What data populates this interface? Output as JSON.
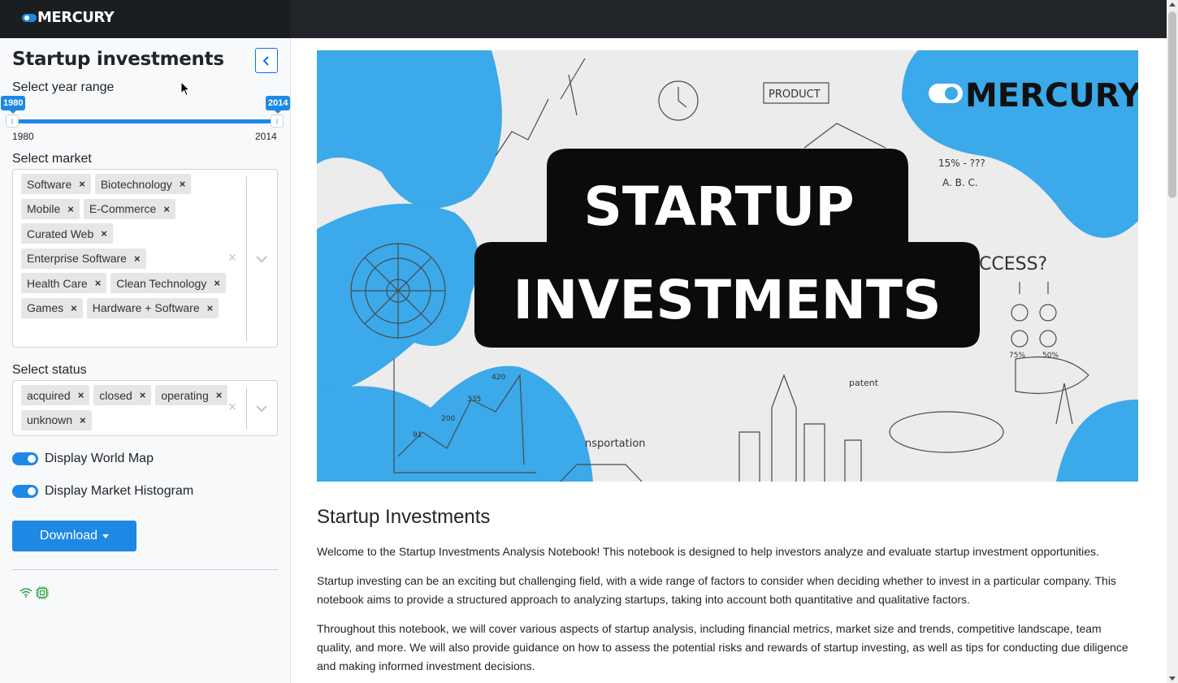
{
  "app": {
    "brand": "MERCURY"
  },
  "sidebar": {
    "title": "Startup investments",
    "year_range": {
      "label": "Select year range",
      "min": 1980,
      "max": 2014,
      "from": 1980,
      "to": 2014,
      "from_label": "1980",
      "to_label": "2014",
      "scale_min_label": "1980",
      "scale_max_label": "2014"
    },
    "market": {
      "label": "Select market",
      "selected": [
        "Software",
        "Biotechnology",
        "Mobile",
        "E-Commerce",
        "Curated Web",
        "Enterprise Software",
        "Health Care",
        "Clean Technology",
        "Games",
        "Hardware + Software"
      ],
      "clear_glyph": "×",
      "remove_glyph": "×"
    },
    "status": {
      "label": "Select status",
      "selected": [
        "acquired",
        "closed",
        "operating",
        "unknown"
      ],
      "clear_glyph": "×",
      "remove_glyph": "×"
    },
    "toggles": {
      "world_map": {
        "label": "Display World Map",
        "on": true
      },
      "market_histogram": {
        "label": "Display Market Histogram",
        "on": true
      }
    },
    "download": {
      "label": "Download"
    },
    "status_icons": [
      "wifi-icon",
      "cpu-icon"
    ]
  },
  "main": {
    "banner": {
      "brand": "MERCURY",
      "line1": "STARTUP",
      "line2": "INVESTMENTS",
      "sketch_labels": [
        "PRODUCT",
        "15% - ???",
        "A. B. C.",
        "CCESS?",
        "420",
        "335",
        "200",
        "91",
        "nsportation",
        "patent",
        "75%",
        "50%"
      ]
    },
    "title": "Startup Investments",
    "paragraphs": [
      "Welcome to the Startup Investments Analysis Notebook! This notebook is designed to help investors analyze and evaluate startup investment opportunities.",
      "Startup investing can be an exciting but challenging field, with a wide range of factors to consider when deciding whether to invest in a particular company. This notebook aims to provide a structured approach to analyzing startups, taking into account both quantitative and qualitative factors.",
      "Throughout this notebook, we will cover various aspects of startup analysis, including financial metrics, market size and trends, competitive landscape, team quality, and more. We will also provide guidance on how to assess the potential risks and rewards of startup investing, as well as tips for conducting due diligence and making informed investment decisions."
    ]
  },
  "colors": {
    "accent": "#1e88e5",
    "topbar": "#212529",
    "banner_blue": "#3ba9ea"
  }
}
